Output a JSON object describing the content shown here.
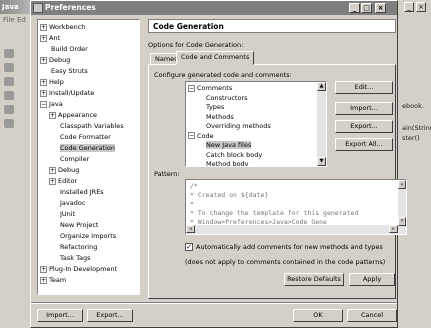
{
  "background": {
    "title": "Java",
    "menu": "File Ed",
    "right_texts": [
      "ebook.",
      "ain(String",
      "ster()"
    ]
  },
  "dialog": {
    "title": "Preferences",
    "controls": [
      "_",
      "□",
      "×"
    ]
  },
  "tree": [
    {
      "label": "Workbench",
      "level": 0,
      "expander": "+"
    },
    {
      "label": "Ant",
      "level": 0,
      "expander": "+"
    },
    {
      "label": "Build Order",
      "level": 0,
      "expander": ""
    },
    {
      "label": "Debug",
      "level": 0,
      "expander": "+"
    },
    {
      "label": "Easy Struts",
      "level": 0,
      "expander": ""
    },
    {
      "label": "Help",
      "level": 0,
      "expander": "+"
    },
    {
      "label": "Install/Update",
      "level": 0,
      "expander": "+"
    },
    {
      "label": "Java",
      "level": 0,
      "expander": "−"
    },
    {
      "label": "Appearance",
      "level": 1,
      "expander": "+"
    },
    {
      "label": "Classpath Variables",
      "level": 1,
      "expander": ""
    },
    {
      "label": "Code Formatter",
      "level": 1,
      "expander": ""
    },
    {
      "label": "Code Generation",
      "level": 1,
      "expander": "",
      "selected": true
    },
    {
      "label": "Compiler",
      "level": 1,
      "expander": ""
    },
    {
      "label": "Debug",
      "level": 1,
      "expander": "+"
    },
    {
      "label": "Editor",
      "level": 1,
      "expander": "+"
    },
    {
      "label": "Installed JREs",
      "level": 1,
      "expander": ""
    },
    {
      "label": "Javadoc",
      "level": 1,
      "expander": ""
    },
    {
      "label": "JUnit",
      "level": 1,
      "expander": ""
    },
    {
      "label": "New Project",
      "level": 1,
      "expander": ""
    },
    {
      "label": "Organize Imports",
      "level": 1,
      "expander": ""
    },
    {
      "label": "Refactoring",
      "level": 1,
      "expander": ""
    },
    {
      "label": "Task Tags",
      "level": 1,
      "expander": ""
    },
    {
      "label": "Plug-In Development",
      "level": 0,
      "expander": "+"
    },
    {
      "label": "Team",
      "level": 0,
      "expander": "+"
    }
  ],
  "panel": {
    "title": "Code Generation",
    "subtitle": "Options for Code Generation:",
    "tabs": [
      "Names",
      "Code and Comments"
    ],
    "configure_label": "Configure generated code and comments:",
    "code_items": [
      {
        "label": "Comments",
        "level": 0,
        "expander": "−"
      },
      {
        "label": "Constructors",
        "level": 1
      },
      {
        "label": "Types",
        "level": 1
      },
      {
        "label": "Methods",
        "level": 1
      },
      {
        "label": "Overriding methods",
        "level": 1
      },
      {
        "label": "Code",
        "level": 0,
        "expander": "−"
      },
      {
        "label": "New Java files",
        "level": 1,
        "selected": true
      },
      {
        "label": "Catch block body",
        "level": 1
      },
      {
        "label": "Method body",
        "level": 1
      }
    ],
    "buttons": {
      "edit": "Edit...",
      "import": "Import...",
      "export": "Export...",
      "export_all": "Export All..."
    },
    "pattern_label": "Pattern:",
    "pattern_lines": [
      "/*",
      " * Created on ${date}",
      " *",
      " * To change the template for this generated",
      " * Window&gt;Preferences&gt;Java&gt;Code Gene"
    ],
    "auto_comments_checked": true,
    "auto_comments_label": "Automatically add comments for new methods and types",
    "note": "(does not apply to comments contained in the code patterns)",
    "restore_defaults": "Restore Defaults",
    "apply": "Apply"
  },
  "footer": {
    "import": "Import...",
    "export": "Export...",
    "ok": "OK",
    "cancel": "Cancel"
  }
}
